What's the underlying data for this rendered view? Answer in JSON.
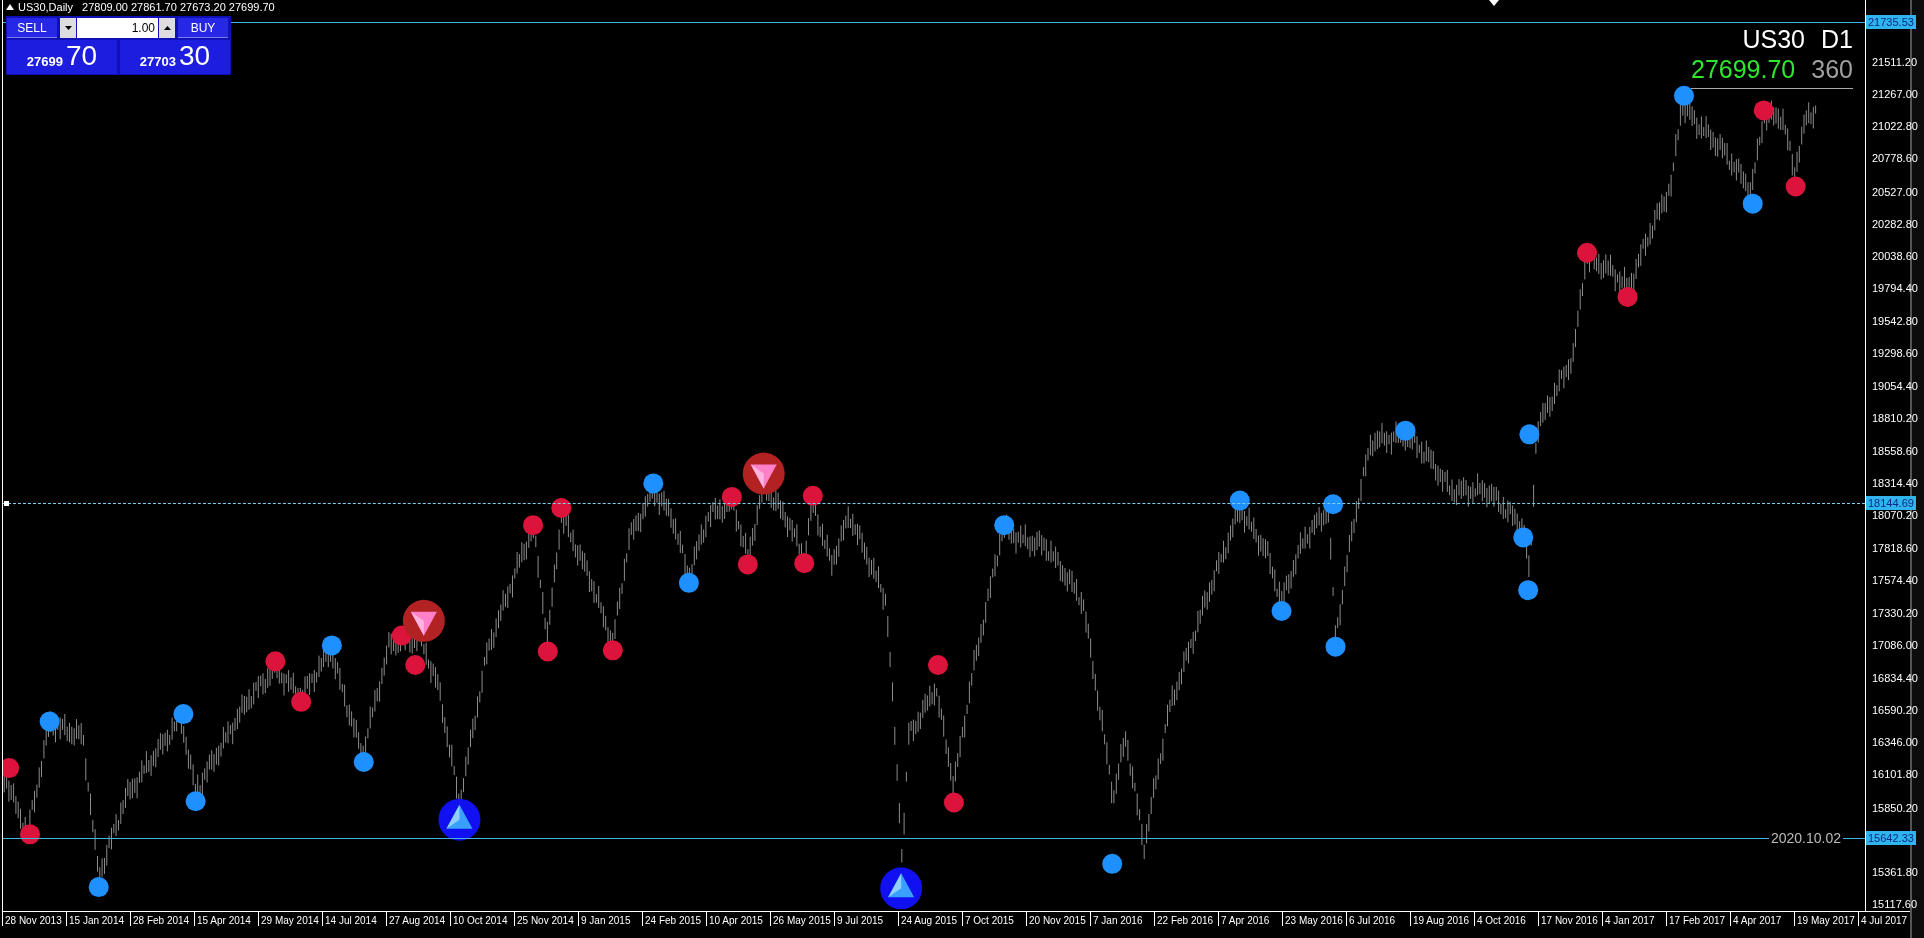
{
  "header": {
    "symbol": "US30,Daily",
    "ohlc": [
      "27809.00",
      "27861.70",
      "27673.20",
      "27699.70"
    ]
  },
  "trade_panel": {
    "sell_label": "SELL",
    "buy_label": "BUY",
    "lot": "1.00",
    "sell_price": {
      "main": "27699",
      "big": "70"
    },
    "buy_price": {
      "main": "27703",
      "big": "30"
    }
  },
  "info": {
    "symbol": "US30",
    "timeframe": "D1",
    "price": "27699.70",
    "spread": "360"
  },
  "price_axis": {
    "ticks": [
      "21511.20",
      "21267.00",
      "21022.80",
      "20778.60",
      "20527.00",
      "20282.80",
      "20038.60",
      "19794.40",
      "19542.80",
      "19298.60",
      "19054.40",
      "18810.20",
      "18558.60",
      "18314.40",
      "18070.20",
      "17818.60",
      "17574.40",
      "17330.20",
      "17086.00",
      "16834.40",
      "16590.20",
      "16346.00",
      "16101.80",
      "15850.20",
      "15361.80",
      "15117.60"
    ]
  },
  "levels": [
    {
      "price": "21735.53",
      "kind": "solid"
    },
    {
      "price": "18144.69",
      "kind": "dashed"
    },
    {
      "price": "15642.33",
      "kind": "solid",
      "note": "2020.10.02"
    }
  ],
  "time_axis": {
    "labels": [
      "28 Nov 2013",
      "15 Jan 2014",
      "28 Feb 2014",
      "15 Apr 2014",
      "29 May 2014",
      "14 Jul 2014",
      "27 Aug 2014",
      "10 Oct 2014",
      "25 Nov 2014",
      "9 Jan 2015",
      "24 Feb 2015",
      "10 Apr 2015",
      "26 May 2015",
      "9 Jul 2015",
      "24 Aug 2015",
      "7 Oct 2015",
      "20 Nov 2015",
      "7 Jan 2016",
      "22 Feb 2016",
      "7 Apr 2016",
      "23 May 2016",
      "6 Jul 2016",
      "19 Aug 2016",
      "4 Oct 2016",
      "17 Nov 2016",
      "4 Jan 2017",
      "17 Feb 2017",
      "4 Apr 2017",
      "19 May 2017",
      "4 Jul 2017"
    ]
  }
}
